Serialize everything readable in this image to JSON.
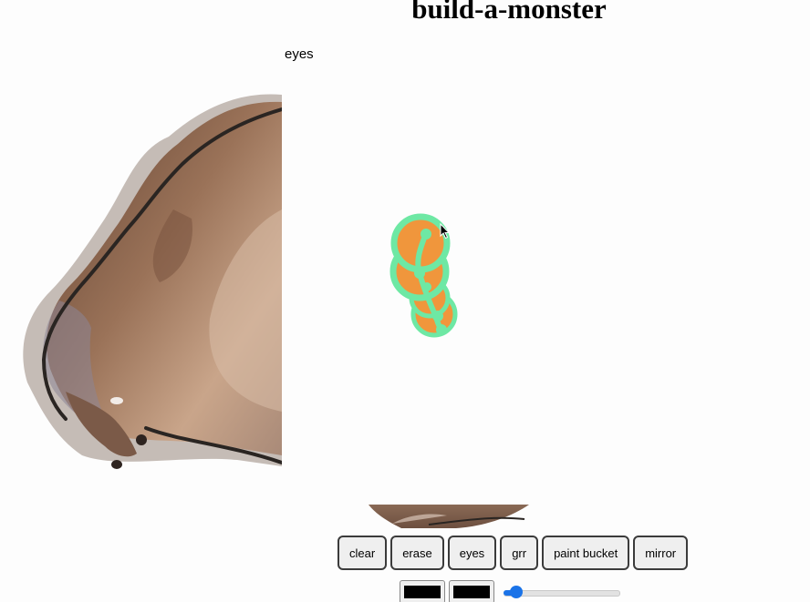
{
  "app": {
    "title": "build-a-monster"
  },
  "status": {
    "current_tool": "eyes"
  },
  "toolbar": {
    "buttons": [
      {
        "id": "clear",
        "label": "clear"
      },
      {
        "id": "erase",
        "label": "erase"
      },
      {
        "id": "eyes",
        "label": "eyes"
      },
      {
        "id": "grr",
        "label": "grr"
      },
      {
        "id": "paint-bucket",
        "label": "paint bucket"
      },
      {
        "id": "mirror",
        "label": "mirror"
      }
    ]
  },
  "controls": {
    "stroke_color": "#000000",
    "fill_color": "#000000",
    "brush_size_fraction": 0.06
  },
  "colors": {
    "eye_outline": "#6ee8a4",
    "eye_iris": "#f0963c",
    "fur_dark": "#6b4a33",
    "fur_light": "#c8a68a"
  }
}
